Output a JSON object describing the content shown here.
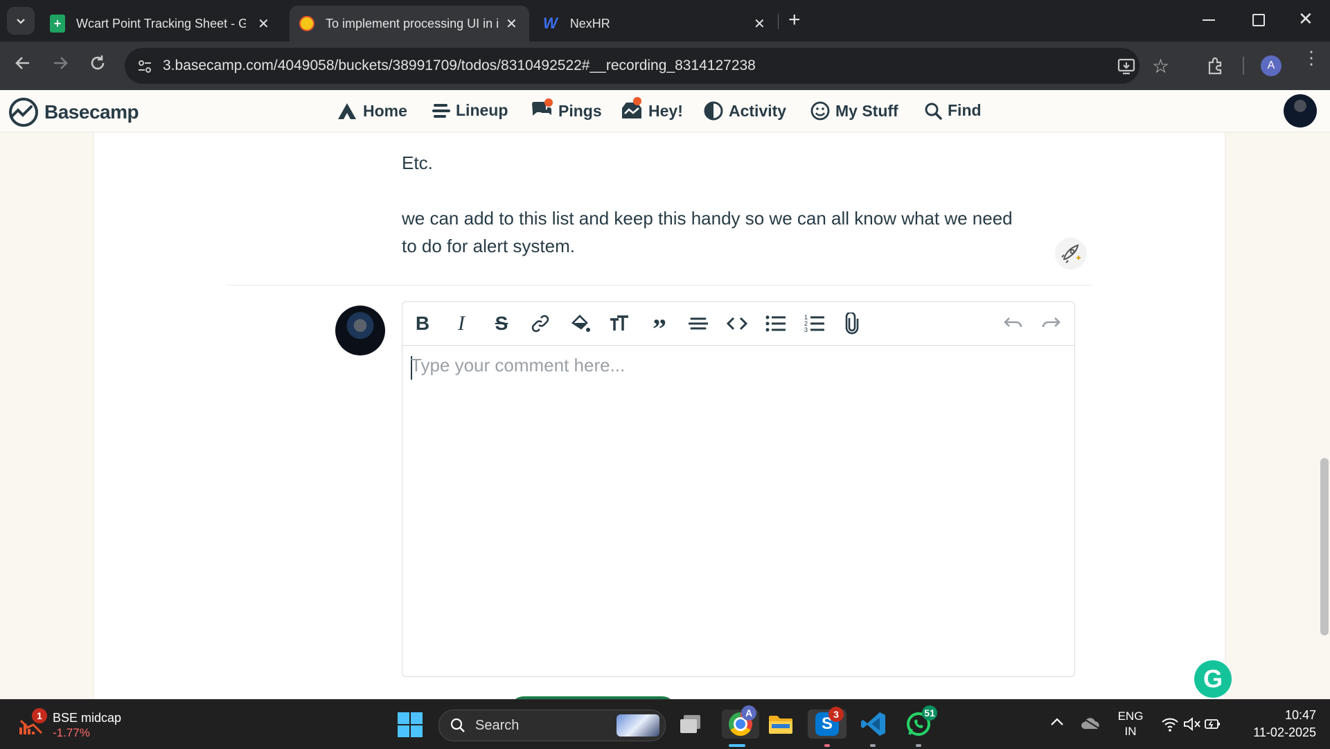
{
  "browser": {
    "tabs": [
      {
        "title": "Wcart Point Tracking Sheet - Gc",
        "icon": "google-sheets-icon"
      },
      {
        "title": "To implement processing UI in i",
        "icon": "basecamp-icon",
        "active": true
      },
      {
        "title": "NexHR",
        "icon": "nexhr-icon"
      }
    ],
    "url": "3.basecamp.com/4049058/buckets/38991709/todos/8310492522#__recording_8314127238",
    "profile_initial": "A"
  },
  "app": {
    "logo": "Basecamp",
    "nav": [
      {
        "label": "Home",
        "icon": "home-icon"
      },
      {
        "label": "Lineup",
        "icon": "lineup-icon"
      },
      {
        "label": "Pings",
        "icon": "pings-icon",
        "dot": true
      },
      {
        "label": "Hey!",
        "icon": "hey-icon",
        "dot": true
      },
      {
        "label": "Activity",
        "icon": "activity-icon"
      },
      {
        "label": "My Stuff",
        "icon": "my-stuff-icon"
      },
      {
        "label": "Find",
        "icon": "find-icon"
      }
    ]
  },
  "content": {
    "line1": "Etc.",
    "line2": "we can add to this list and keep this handy so we can all know what we need",
    "line3": "to do for alert system."
  },
  "editor": {
    "placeholder": "Type your comment here...",
    "tools": [
      "bold-icon",
      "italic-icon",
      "strikethrough-icon",
      "link-icon",
      "highlight-icon",
      "text-size-icon",
      "quote-icon",
      "horizontal-rule-icon",
      "code-icon",
      "bullet-list-icon",
      "numbered-list-icon",
      "attachment-icon"
    ]
  },
  "taskbar": {
    "widget_title": "BSE midcap",
    "widget_value": "-1.77%",
    "widget_badge": "1",
    "search_label": "Search",
    "skype_badge": "3",
    "whatsapp_badge": "51",
    "chrome_badge": "A",
    "lang_line1": "ENG",
    "lang_line2": "IN",
    "time": "10:47",
    "date": "11-02-2025"
  },
  "colors": {
    "brand_text": "#283c46",
    "notify_dot": "#ec5a29",
    "grammarly": "#15c39a",
    "widget_negative": "#ff6b6b"
  }
}
